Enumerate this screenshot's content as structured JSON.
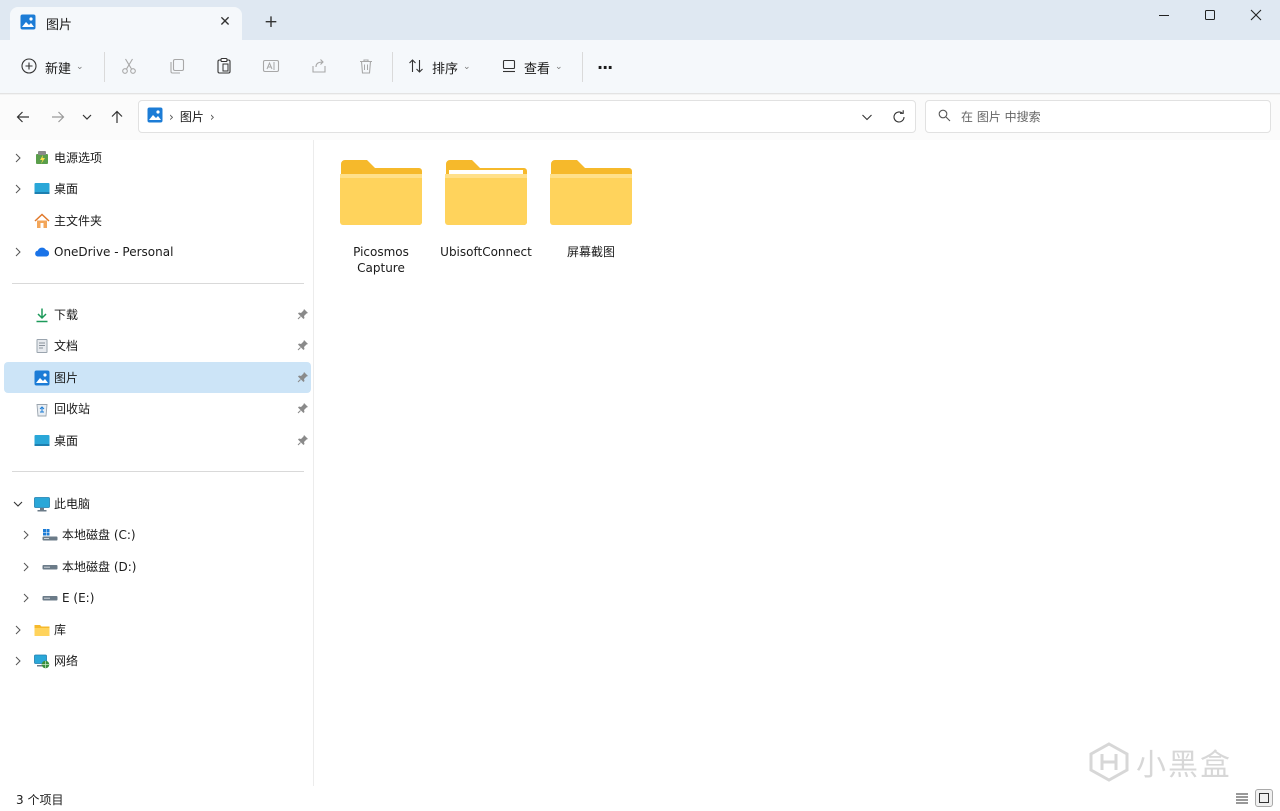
{
  "window": {
    "tab_title": "图片",
    "tab_icon": "pictures-icon",
    "new_tab_symbol": "+"
  },
  "toolbar": {
    "new_label": "新建",
    "sort_label": "排序",
    "view_label": "查看",
    "more_symbol": "···",
    "icons": [
      "cut-icon",
      "copy-icon",
      "paste-icon",
      "rename-icon",
      "share-icon",
      "delete-icon"
    ]
  },
  "address": {
    "breadcrumb": [
      "图片"
    ],
    "search_placeholder": "在 图片 中搜索"
  },
  "sidebar": {
    "top": [
      {
        "label": "电源选项",
        "icon": "power-options-icon",
        "expandable": true
      },
      {
        "label": "桌面",
        "icon": "desktop-icon",
        "expandable": true
      },
      {
        "label": "主文件夹",
        "icon": "home-icon",
        "expandable": false
      },
      {
        "label": "OneDrive - Personal",
        "icon": "onedrive-icon",
        "expandable": true
      }
    ],
    "quick_access": [
      {
        "label": "下载",
        "icon": "download-icon",
        "pinned": true
      },
      {
        "label": "文档",
        "icon": "documents-icon",
        "pinned": true
      },
      {
        "label": "图片",
        "icon": "pictures-icon",
        "pinned": true,
        "selected": true
      },
      {
        "label": "回收站",
        "icon": "recycle-bin-icon",
        "pinned": true
      },
      {
        "label": "桌面",
        "icon": "desktop-icon",
        "pinned": true
      }
    ],
    "this_pc": {
      "label": "此电脑",
      "icon": "computer-icon",
      "expanded": true
    },
    "drives": [
      {
        "label": "本地磁盘 (C:)",
        "icon": "system-drive-icon"
      },
      {
        "label": "本地磁盘 (D:)",
        "icon": "drive-icon"
      },
      {
        "label": "E (E:)",
        "icon": "drive-icon"
      }
    ],
    "bottom": [
      {
        "label": "库",
        "icon": "library-icon"
      },
      {
        "label": "网络",
        "icon": "network-icon"
      }
    ]
  },
  "folders": [
    {
      "name": "Picosmos Capture"
    },
    {
      "name": "UbisoftConnect"
    },
    {
      "name": "屏幕截图"
    }
  ],
  "status": {
    "item_count": "3 个项目"
  },
  "watermark": {
    "text": "小黑盒"
  },
  "colors": {
    "selected_bg": "#cce4f7",
    "folder_front": "#ffd35c",
    "folder_back": "#f6b92b",
    "accent_blue": "#1c7cd6"
  }
}
